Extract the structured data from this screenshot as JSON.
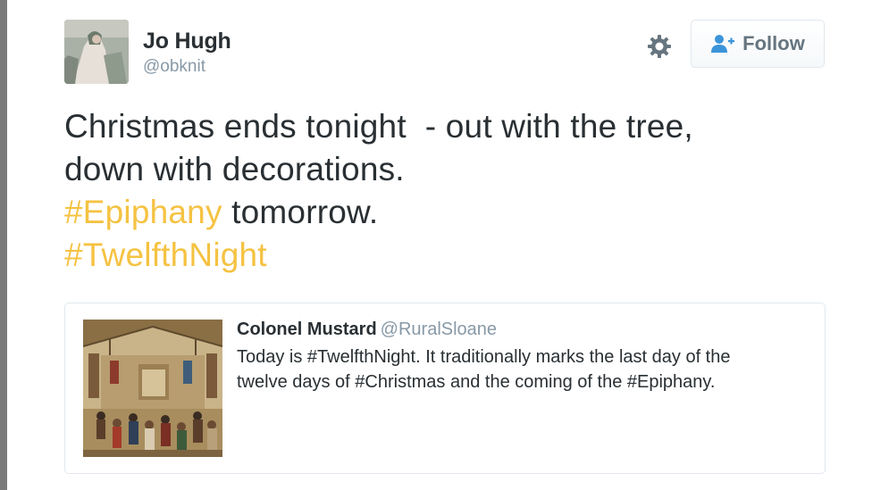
{
  "tweet": {
    "user": {
      "name": "Jo Hugh",
      "handle": "@obknit"
    },
    "follow_button": {
      "label": "Follow",
      "icon": "add-user-icon"
    },
    "settings_icon": "gear-icon",
    "text": {
      "line1": "Christmas ends tonight  - out with the tree,",
      "line2": "down with decorations.",
      "hashtag1": "#Epiphany",
      "line3_rest": " tomorrow.",
      "hashtag2": "#TwelfthNight"
    },
    "quoted_tweet": {
      "author_name": "Colonel Mustard",
      "author_handle": "@RuralSloane",
      "text_line1": "Today is #TwelfthNight. It traditionally marks the last day of the",
      "text_line2": "twelve days of #Christmas and the coming of the #Epiphany."
    }
  },
  "colors": {
    "hashtag": "#f5c242",
    "handle": "#8899a6",
    "text": "#292f33",
    "border": "#e1e8ed"
  }
}
